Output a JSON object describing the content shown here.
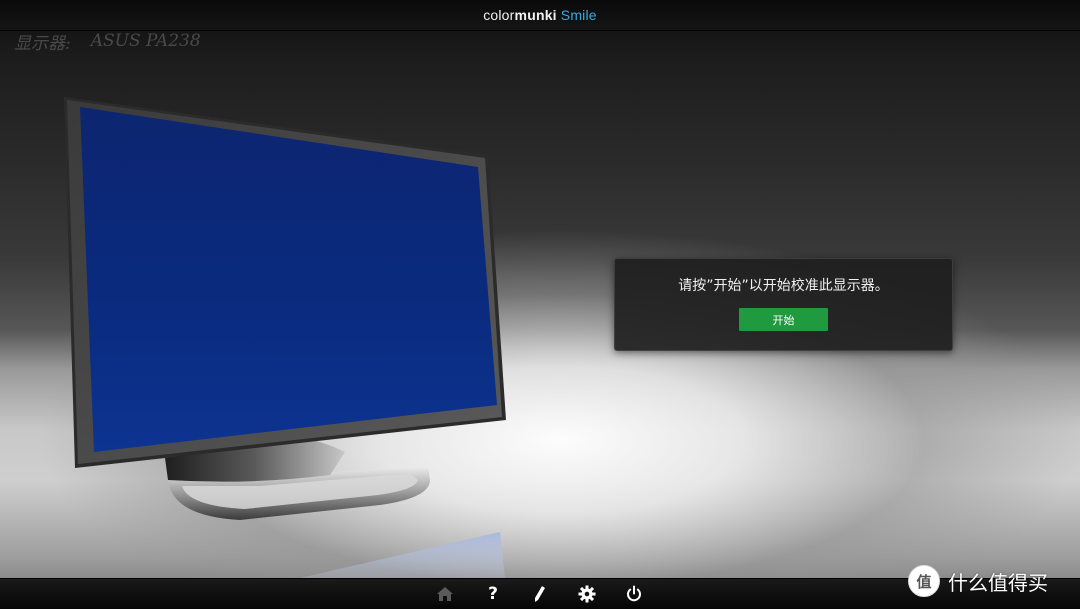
{
  "app": {
    "brand_part1": "color",
    "brand_part2": "munki",
    "brand_part3": "Smile"
  },
  "display": {
    "label": "显示器:",
    "name": "ASUS PA238"
  },
  "dialog": {
    "message": "请按”开始”以开始校准此显示器。",
    "start_label": "开始"
  },
  "toolbar": {
    "items": [
      "home-icon",
      "help-icon",
      "edit-icon",
      "settings-icon",
      "power-icon"
    ],
    "help_glyph": "?"
  },
  "watermark": {
    "text": "什么值得买",
    "logo_text": "值"
  },
  "colors": {
    "accent": "#3ba9e0",
    "start_button": "#1f9a3e",
    "screen": "#0a2a78"
  }
}
